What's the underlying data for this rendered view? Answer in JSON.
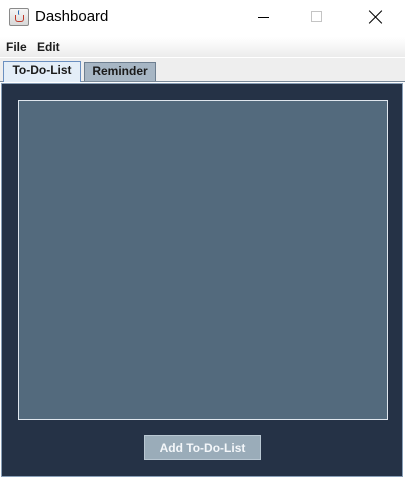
{
  "window": {
    "title": "Dashboard",
    "icon": "java-coffee-cup-icon"
  },
  "menu": {
    "items": [
      "File",
      "Edit"
    ]
  },
  "tabs": [
    {
      "label": "To-Do-List",
      "selected": true
    },
    {
      "label": "Reminder",
      "selected": false
    }
  ],
  "todo_panel": {
    "items": [],
    "add_button_label": "Add To-Do-List"
  },
  "colors": {
    "panel_background": "#253246",
    "list_background": "#536a7d",
    "button_background": "#9aacb9"
  }
}
